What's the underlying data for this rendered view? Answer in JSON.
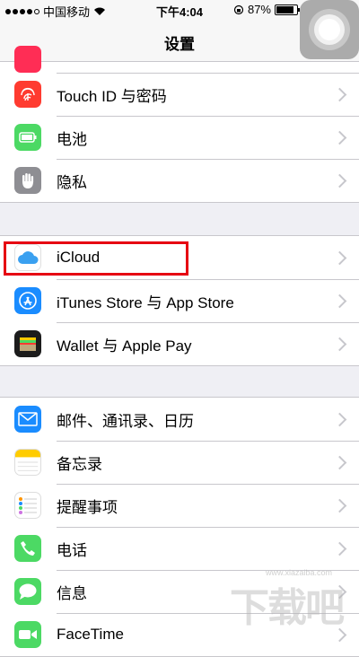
{
  "status_bar": {
    "carrier": "中国移动",
    "time": "下午4:04",
    "battery_text": "87%",
    "battery_level": 0.87
  },
  "nav": {
    "title": "设置"
  },
  "group1": [
    {
      "label": "Touch ID 与密码",
      "icon": "fingerprint-icon",
      "color": "#ff3b30"
    },
    {
      "label": "电池",
      "icon": "battery-icon",
      "color": "#4cd964"
    },
    {
      "label": "隐私",
      "icon": "hand-icon",
      "color": "#8e8e93"
    }
  ],
  "group2": [
    {
      "label": "iCloud",
      "icon": "icloud-icon",
      "color": "#ffffff"
    },
    {
      "label": "iTunes Store 与 App Store",
      "icon": "app-store-icon",
      "color": "#1a8cff"
    },
    {
      "label": "Wallet 与 Apple Pay",
      "icon": "wallet-icon",
      "color": "#000000"
    }
  ],
  "group3": [
    {
      "label": "邮件、通讯录、日历",
      "icon": "mail-icon",
      "color": "#1a8cff"
    },
    {
      "label": "备忘录",
      "icon": "notes-icon",
      "color": "#ffcc00"
    },
    {
      "label": "提醒事项",
      "icon": "reminders-icon",
      "color": "#ffffff"
    },
    {
      "label": "电话",
      "icon": "phone-icon",
      "color": "#4cd964"
    },
    {
      "label": "信息",
      "icon": "messages-icon",
      "color": "#4cd964"
    },
    {
      "label": "FaceTime",
      "icon": "facetime-icon",
      "color": "#4cd964"
    }
  ],
  "watermark": {
    "text": "下载吧",
    "url": "www.xiazaiba.com"
  },
  "highlight_color": "#e60012"
}
